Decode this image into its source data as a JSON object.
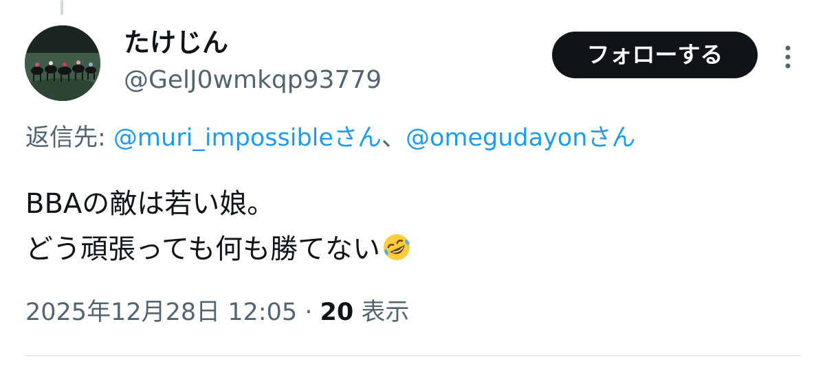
{
  "tweet": {
    "author": {
      "display_name": "たけじん",
      "handle": "@GelJ0wmkqp93779"
    },
    "follow_label": "フォローする",
    "reply_to": {
      "prefix": "返信先: ",
      "mentions": [
        "@muri_impossible",
        "@omegudayon"
      ],
      "suffix": "さん",
      "separator": "、"
    },
    "text_lines": [
      "BBAの敵は若い娘。",
      "どう頑張っても何も勝てない"
    ],
    "emoji": "rolling-on-floor-laughing",
    "timestamp": "2025年12月28日 12:05",
    "dot_separator": " · ",
    "views_count": "20",
    "views_label": " 表示"
  },
  "icons": {
    "more": "more-vertical-icon"
  },
  "colors": {
    "link": "#1d9bf0",
    "secondary_text": "#536471",
    "primary_text": "#0f1419",
    "follow_button_bg": "#0f1419"
  }
}
